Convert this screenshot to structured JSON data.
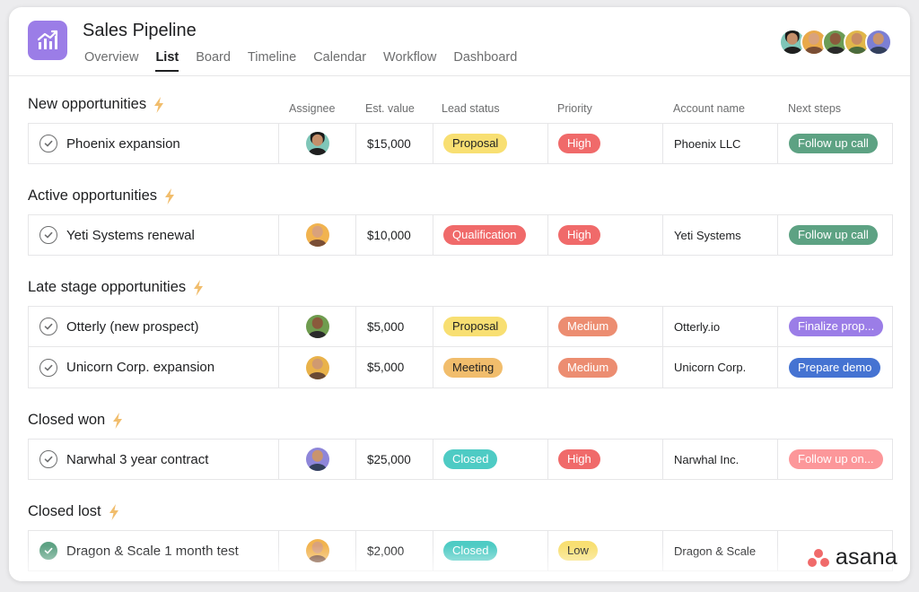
{
  "header": {
    "title": "Sales Pipeline",
    "tabs": [
      "Overview",
      "List",
      "Board",
      "Timeline",
      "Calendar",
      "Workflow",
      "Dashboard"
    ],
    "active_tab": "List",
    "app_icon": "chart-line-icon",
    "accent": "#9b7de7"
  },
  "columns": {
    "assignee": "Assignee",
    "value": "Est. value",
    "lead": "Lead status",
    "priority": "Priority",
    "account": "Account name",
    "next": "Next steps"
  },
  "sections": [
    {
      "title": "New opportunities",
      "rows": [
        {
          "task": "Phoenix expansion",
          "value": "$15,000",
          "lead": "Proposal",
          "priority": "High",
          "account": "Phoenix LLC",
          "next": "Follow up call",
          "done": false
        }
      ]
    },
    {
      "title": "Active opportunities",
      "rows": [
        {
          "task": "Yeti Systems renewal",
          "value": "$10,000",
          "lead": "Qualification",
          "priority": "High",
          "account": "Yeti Systems",
          "next": "Follow up call",
          "done": false
        }
      ]
    },
    {
      "title": "Late stage opportunities",
      "rows": [
        {
          "task": "Otterly (new prospect)",
          "value": "$5,000",
          "lead": "Proposal",
          "priority": "Medium",
          "account": "Otterly.io",
          "next": "Finalize prop...",
          "done": false
        },
        {
          "task": "Unicorn Corp. expansion",
          "value": "$5,000",
          "lead": "Meeting",
          "priority": "Medium",
          "account": "Unicorn Corp.",
          "next": "Prepare demo",
          "done": false
        }
      ]
    },
    {
      "title": "Closed won",
      "rows": [
        {
          "task": "Narwhal 3 year contract",
          "value": "$25,000",
          "lead": "Closed",
          "priority": "High",
          "account": "Narwhal Inc.",
          "next": "Follow up on...",
          "done": false
        }
      ]
    },
    {
      "title": "Closed lost",
      "rows": [
        {
          "task": "Dragon & Scale 1 month test",
          "value": "$2,000",
          "lead": "Closed",
          "priority": "Low",
          "account": "Dragon & Scale",
          "next": "",
          "done": true
        }
      ]
    }
  ],
  "colors": {
    "Proposal": "#f8df72",
    "Qualification": "#f06a6a",
    "Meeting": "#f1bd6c",
    "Closed": "#4ecbc4",
    "High": "#f06a6a",
    "Medium": "#ec8d71",
    "Low": "#f8df72",
    "Follow up call": "#5da283",
    "Finalize prop...": "#9b7de7",
    "Prepare demo": "#4573d2",
    "Follow up on...": "#fc979a"
  },
  "brand": {
    "name": "asana",
    "logo_color": "#f06a6a"
  }
}
